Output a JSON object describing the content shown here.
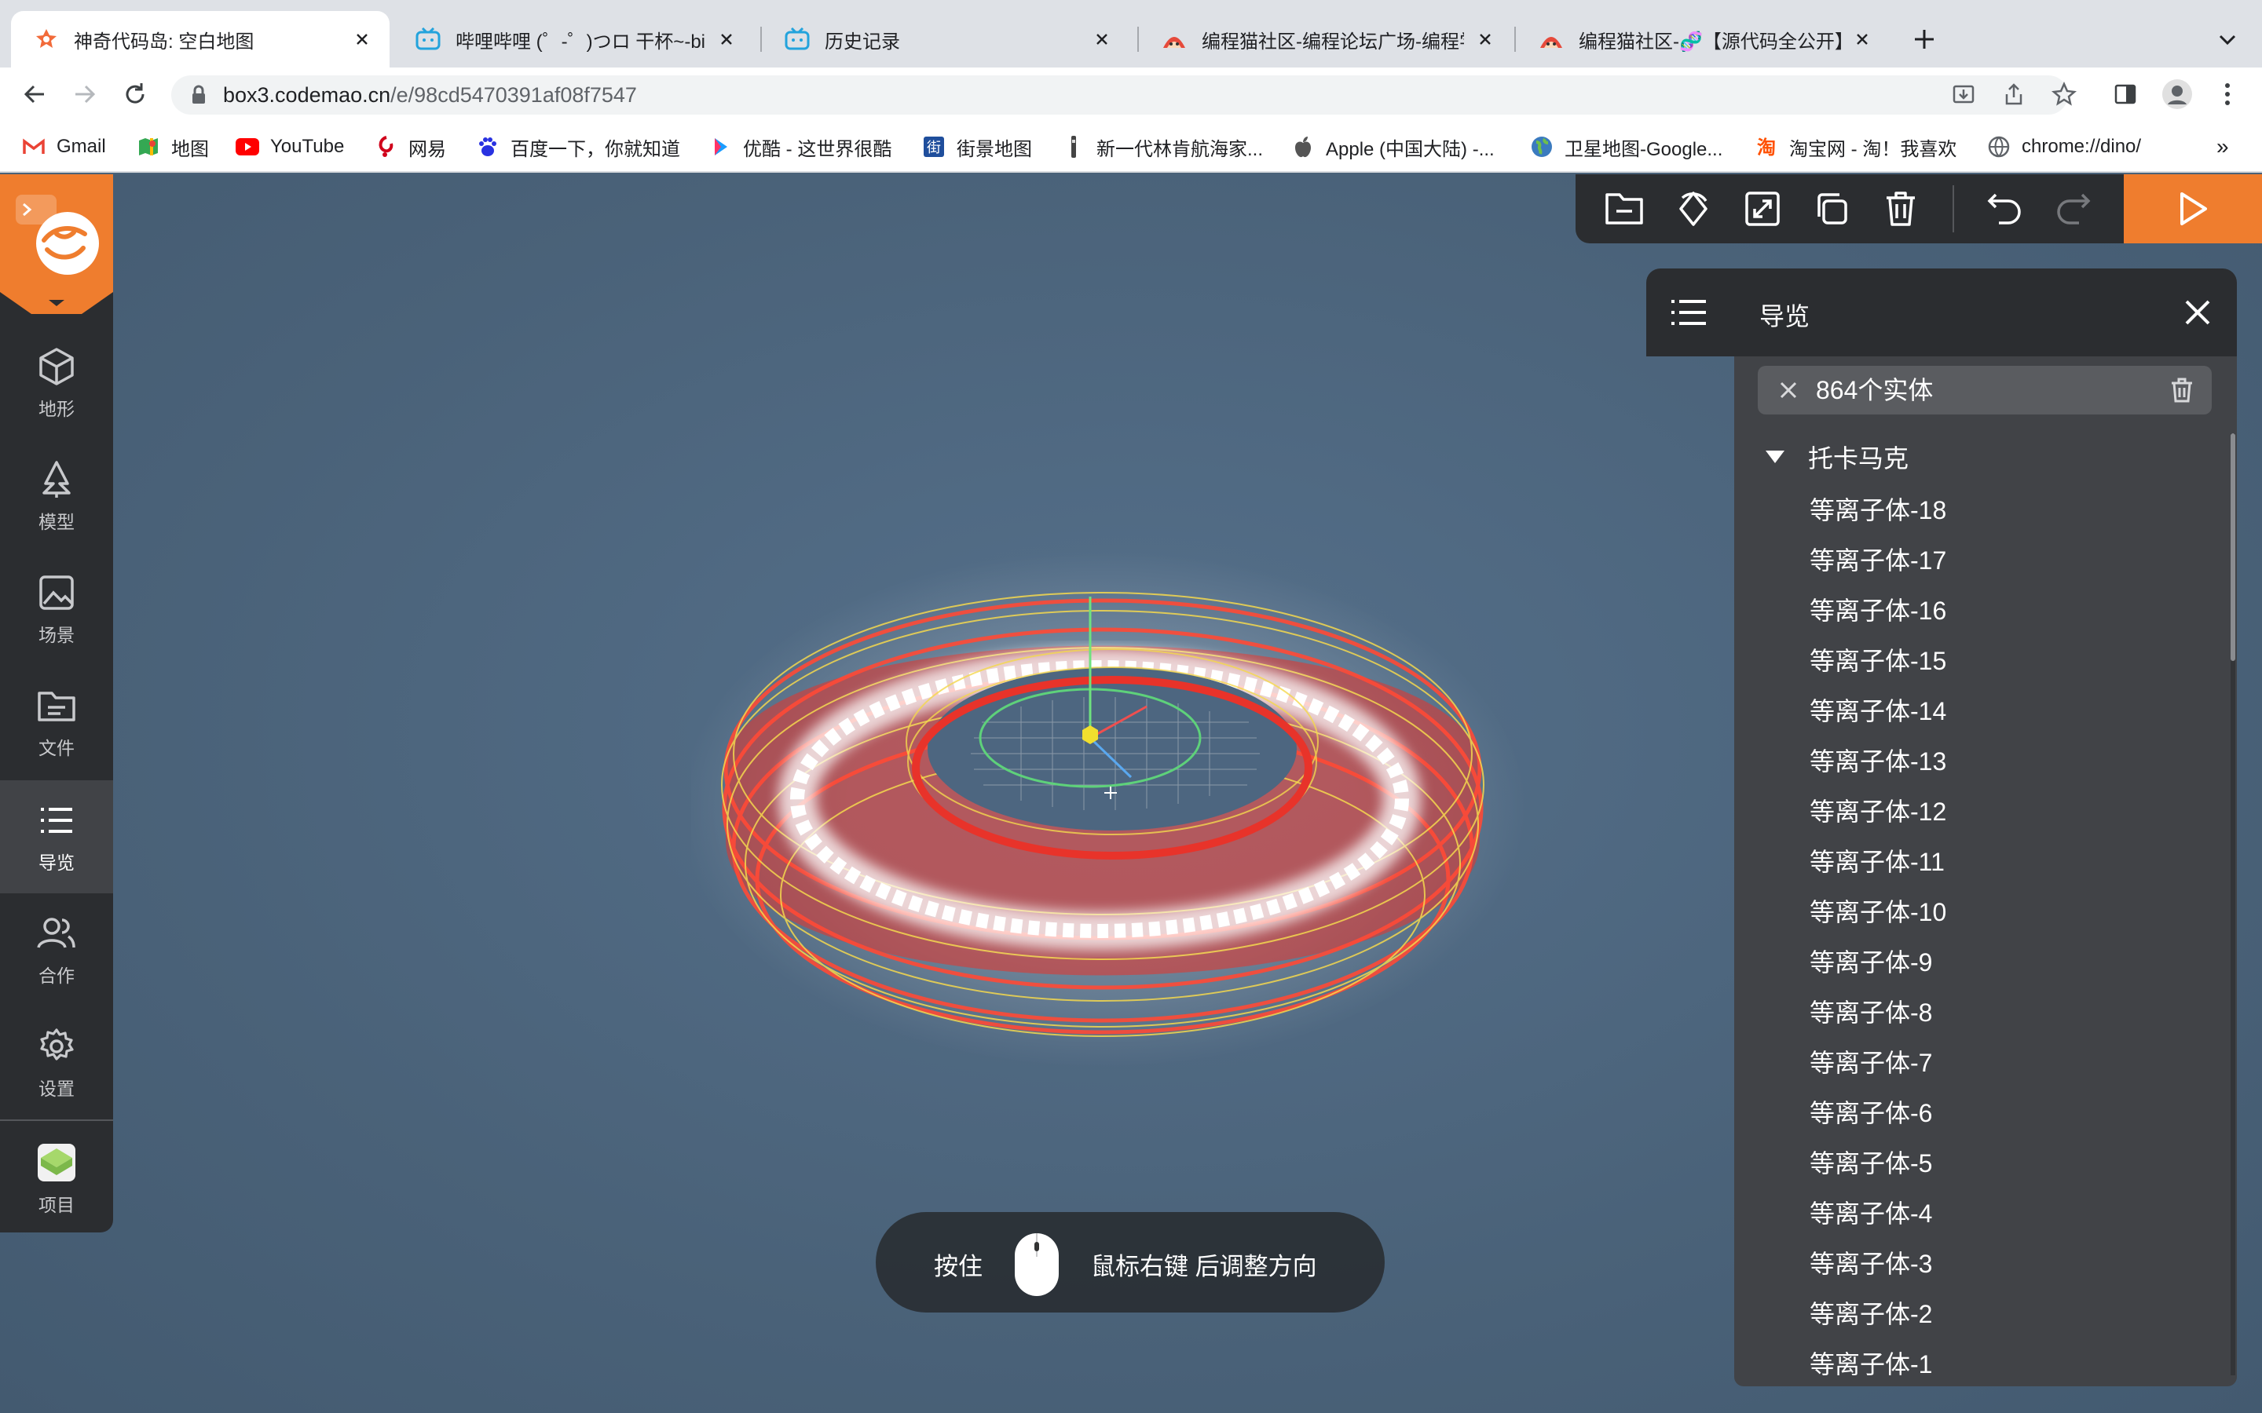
{
  "browser": {
    "tabs": [
      {
        "title": "神奇代码岛: 空白地图",
        "active": true,
        "icon": "codemao-island-icon"
      },
      {
        "title": "哔哩哔哩 (゜-゜)つロ 干杯~-bilibili",
        "active": false,
        "icon": "bilibili-icon"
      },
      {
        "title": "历史记录",
        "active": false,
        "icon": "bilibili-icon"
      },
      {
        "title": "编程猫社区-编程论坛广场-编程学习",
        "active": false,
        "icon": "codemao-cat-icon"
      },
      {
        "title": "编程猫社区-🧬【源代码全公开】",
        "active": false,
        "icon": "codemao-cat-icon"
      }
    ],
    "url": {
      "host": "box3.codemao.cn",
      "path": "/e/98cd5470391af08f7547"
    },
    "bookmarks": [
      {
        "label": "Gmail",
        "icon": "gmail-icon"
      },
      {
        "label": "地图",
        "icon": "maps-icon"
      },
      {
        "label": "YouTube",
        "icon": "youtube-icon"
      },
      {
        "label": "网易",
        "icon": "netease-icon"
      },
      {
        "label": "百度一下，你就知道",
        "icon": "baidu-icon"
      },
      {
        "label": "优酷 - 这世界很酷",
        "icon": "youku-icon"
      },
      {
        "label": "街景地图",
        "icon": "streetview-icon"
      },
      {
        "label": "新一代林肯航海家...",
        "icon": "lincoln-icon"
      },
      {
        "label": "Apple (中国大陆) -...",
        "icon": "apple-icon"
      },
      {
        "label": "卫星地图-Google...",
        "icon": "globe-icon"
      },
      {
        "label": "淘宝网 - 淘！我喜欢",
        "icon": "taobao-icon"
      },
      {
        "label": "chrome://dino/",
        "icon": "chrome-globe-icon"
      }
    ],
    "more_bookmarks": "»"
  },
  "sidebar": {
    "items": [
      {
        "label": "地形",
        "icon": "cube-icon",
        "active": false
      },
      {
        "label": "模型",
        "icon": "tree-icon",
        "active": false
      },
      {
        "label": "场景",
        "icon": "image-icon",
        "active": false
      },
      {
        "label": "文件",
        "icon": "folder-icon",
        "active": false
      },
      {
        "label": "导览",
        "icon": "list-icon",
        "active": true
      },
      {
        "label": "合作",
        "icon": "users-icon",
        "active": false
      },
      {
        "label": "设置",
        "icon": "gear-icon",
        "active": false
      }
    ],
    "project_label": "项目"
  },
  "panel": {
    "title": "导览",
    "search_value": "864个实体",
    "root": "托卡马克",
    "entities": [
      "等离子体-18",
      "等离子体-17",
      "等离子体-16",
      "等离子体-15",
      "等离子体-14",
      "等离子体-13",
      "等离子体-12",
      "等离子体-11",
      "等离子体-10",
      "等离子体-9",
      "等离子体-8",
      "等离子体-7",
      "等离子体-6",
      "等离子体-5",
      "等离子体-4",
      "等离子体-3",
      "等离子体-2",
      "等离子体-1"
    ]
  },
  "hint": {
    "press": "按住",
    "action": "鼠标右键  后调整方向"
  },
  "colors": {
    "accent": "#ef7d2e",
    "torus_red": "#e8332a",
    "torus_yellow": "#f2d24a",
    "sidebar_bg": "#2b2d30"
  }
}
